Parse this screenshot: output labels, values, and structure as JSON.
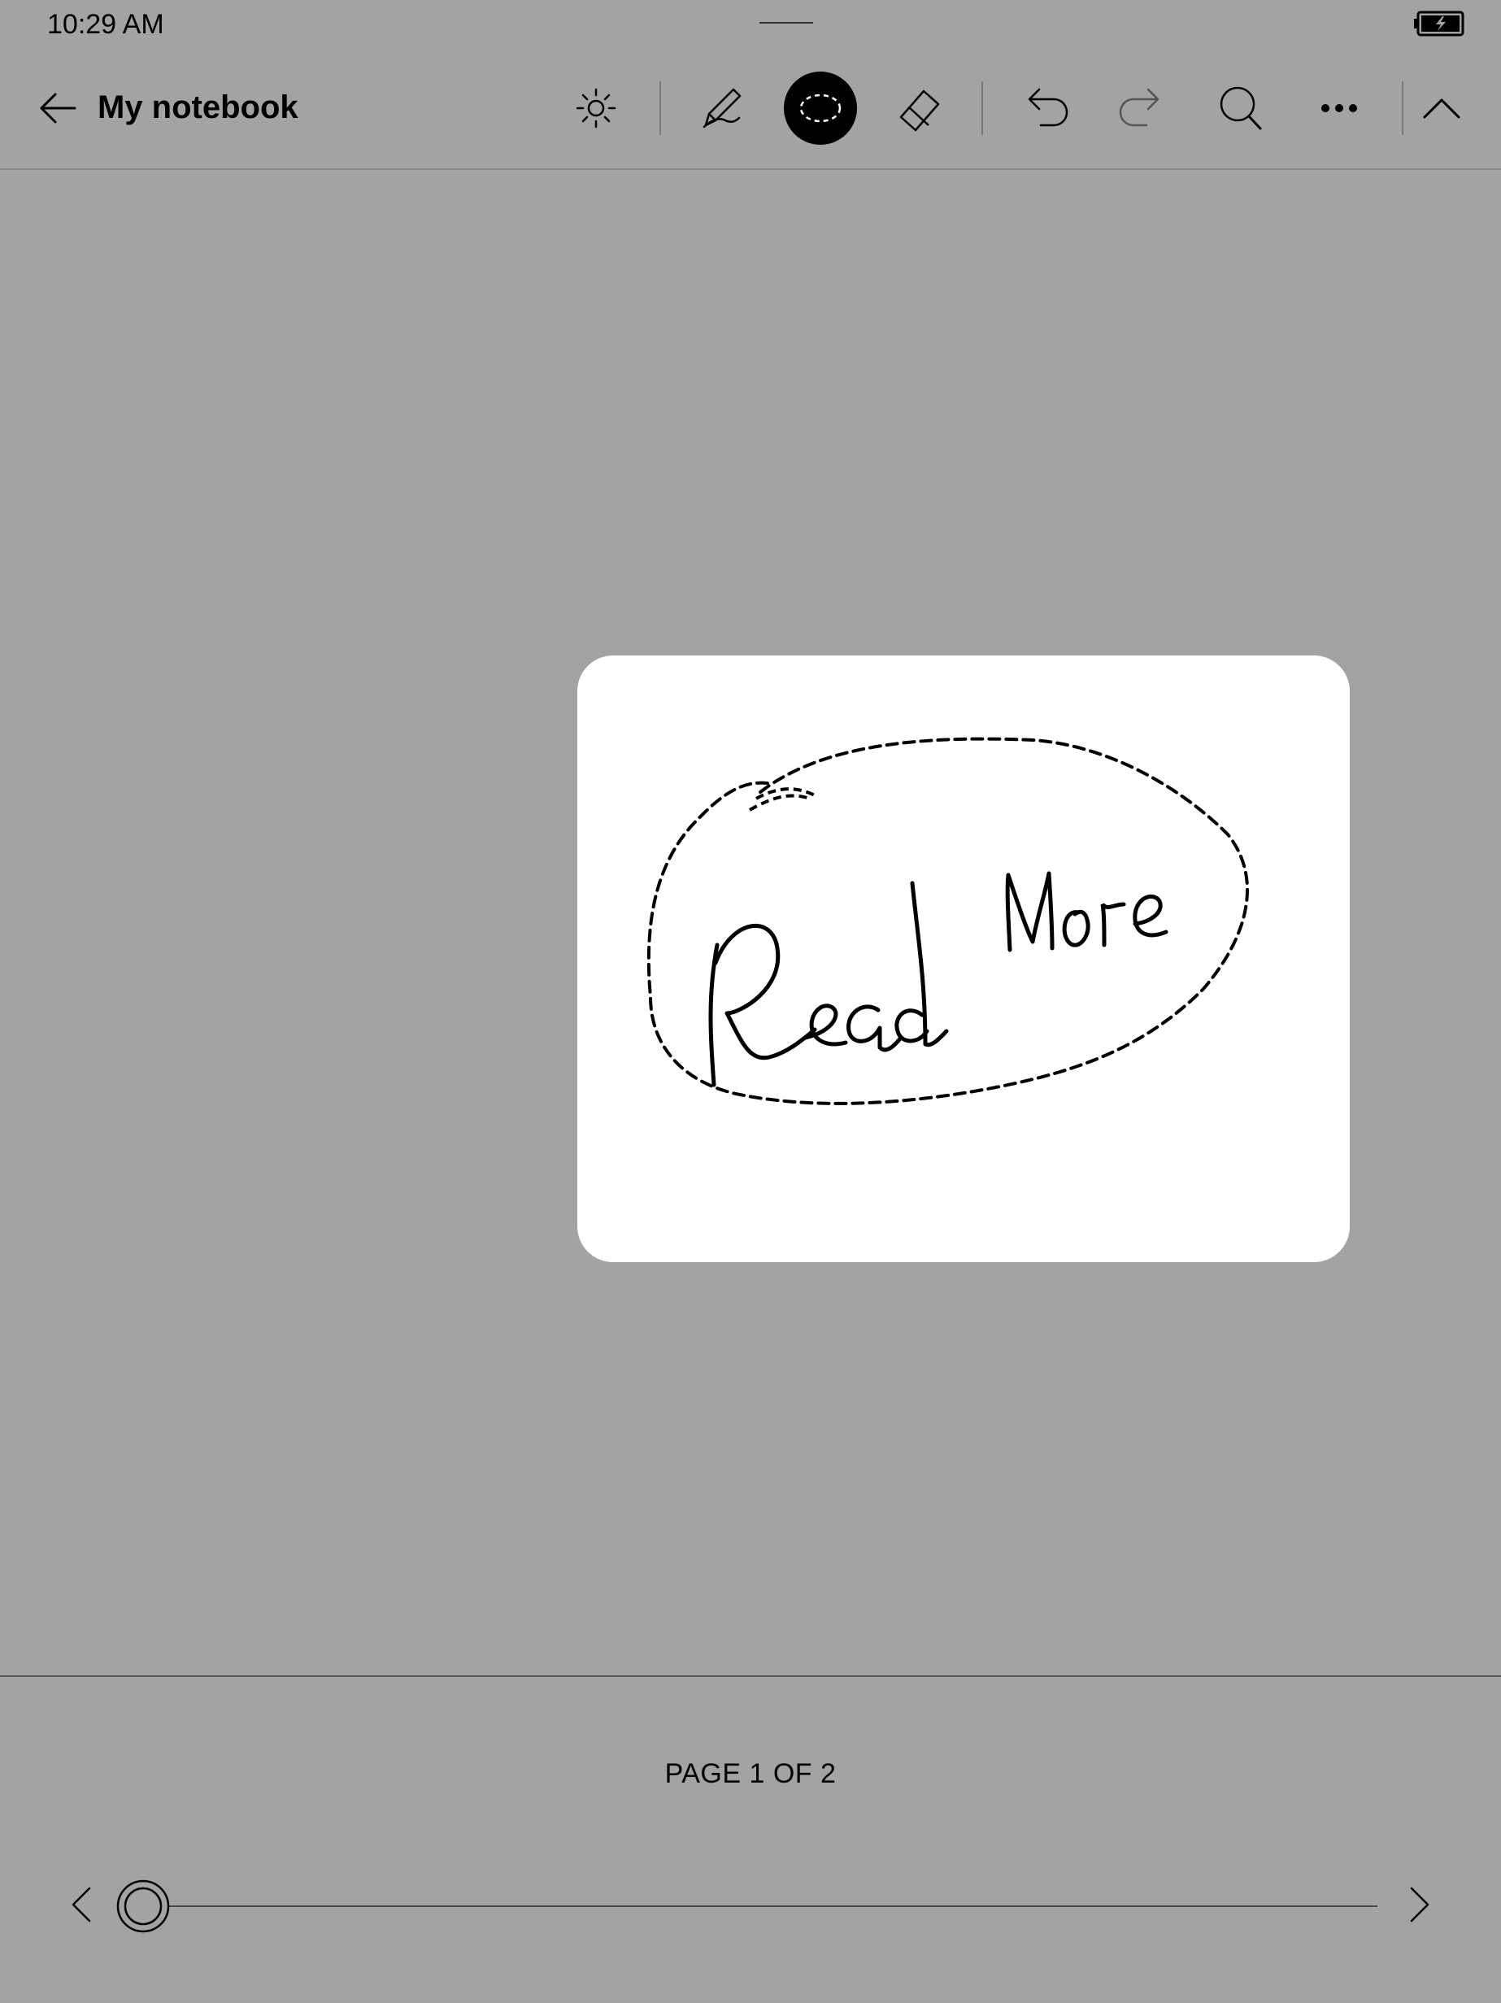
{
  "status_bar": {
    "time": "10:29 AM",
    "battery_icon": "battery-charging-icon"
  },
  "toolbar": {
    "back_icon": "back-arrow-icon",
    "title": "My notebook",
    "tools": [
      {
        "name": "brightness",
        "icon": "sun-icon"
      },
      {
        "name": "pen",
        "icon": "pen-icon"
      },
      {
        "name": "lasso",
        "icon": "lasso-select-icon",
        "active": true
      },
      {
        "name": "eraser",
        "icon": "eraser-icon"
      },
      {
        "name": "undo",
        "icon": "undo-icon"
      },
      {
        "name": "redo",
        "icon": "redo-icon"
      },
      {
        "name": "search",
        "icon": "search-icon"
      },
      {
        "name": "more",
        "icon": "more-icon"
      },
      {
        "name": "collapse",
        "icon": "chevron-up-icon"
      }
    ]
  },
  "selection_card": {
    "handwritten_text": "Read More"
  },
  "footer": {
    "page_label": "PAGE 1 OF 2",
    "current_page": 1,
    "total_pages": 2,
    "prev_icon": "chevron-left-icon",
    "next_icon": "chevron-right-icon",
    "slider_position": 0
  },
  "colors": {
    "background": "#a3a3a3",
    "card": "#ffffff",
    "active_tool": "#000000"
  }
}
